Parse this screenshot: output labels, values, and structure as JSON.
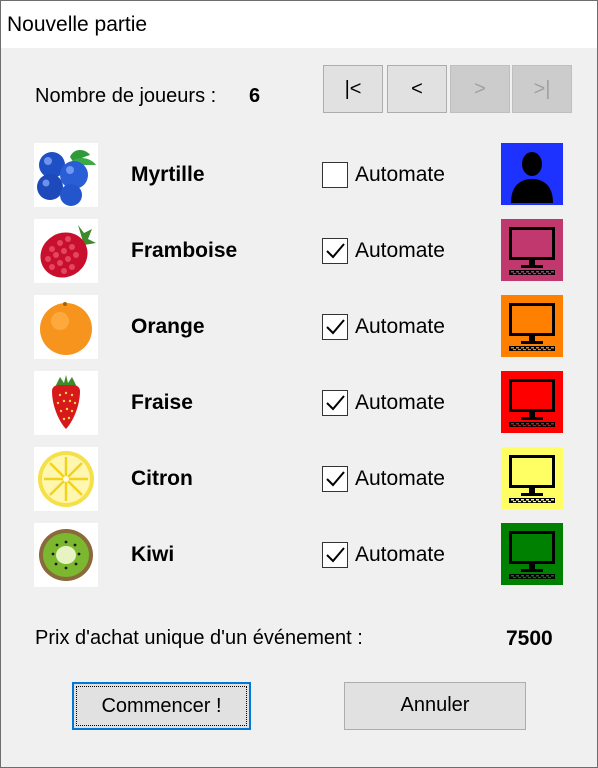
{
  "window": {
    "title": "Nouvelle partie"
  },
  "players": {
    "count_label": "Nombre de joueurs :",
    "count_value": "6",
    "nav": {
      "first": "|<",
      "prev": "<",
      "next": ">",
      "last": ">|"
    }
  },
  "rows": [
    {
      "name": "Myrtille",
      "fruit_icon": "blueberry-icon",
      "automate_checked": false,
      "automate_label": "Automate",
      "player_icon": "human-user-icon",
      "color": "#1e32ff"
    },
    {
      "name": "Framboise",
      "fruit_icon": "raspberry-icon",
      "automate_checked": true,
      "automate_label": "Automate",
      "player_icon": "computer-player-icon",
      "color": "#c0386e"
    },
    {
      "name": "Orange",
      "fruit_icon": "orange-icon",
      "automate_checked": true,
      "automate_label": "Automate",
      "player_icon": "computer-player-icon",
      "color": "#ff8000"
    },
    {
      "name": "Fraise",
      "fruit_icon": "strawberry-icon",
      "automate_checked": true,
      "automate_label": "Automate",
      "player_icon": "computer-player-icon",
      "color": "#ff0000"
    },
    {
      "name": "Citron",
      "fruit_icon": "lemon-icon",
      "automate_checked": true,
      "automate_label": "Automate",
      "player_icon": "computer-player-icon",
      "color": "#ffff64"
    },
    {
      "name": "Kiwi",
      "fruit_icon": "kiwi-icon",
      "automate_checked": true,
      "automate_label": "Automate",
      "player_icon": "computer-player-icon",
      "color": "#008000"
    }
  ],
  "price": {
    "label": "Prix d'achat unique d'un événement :",
    "value": "7500"
  },
  "actions": {
    "start": "Commencer !",
    "cancel": "Annuler"
  }
}
